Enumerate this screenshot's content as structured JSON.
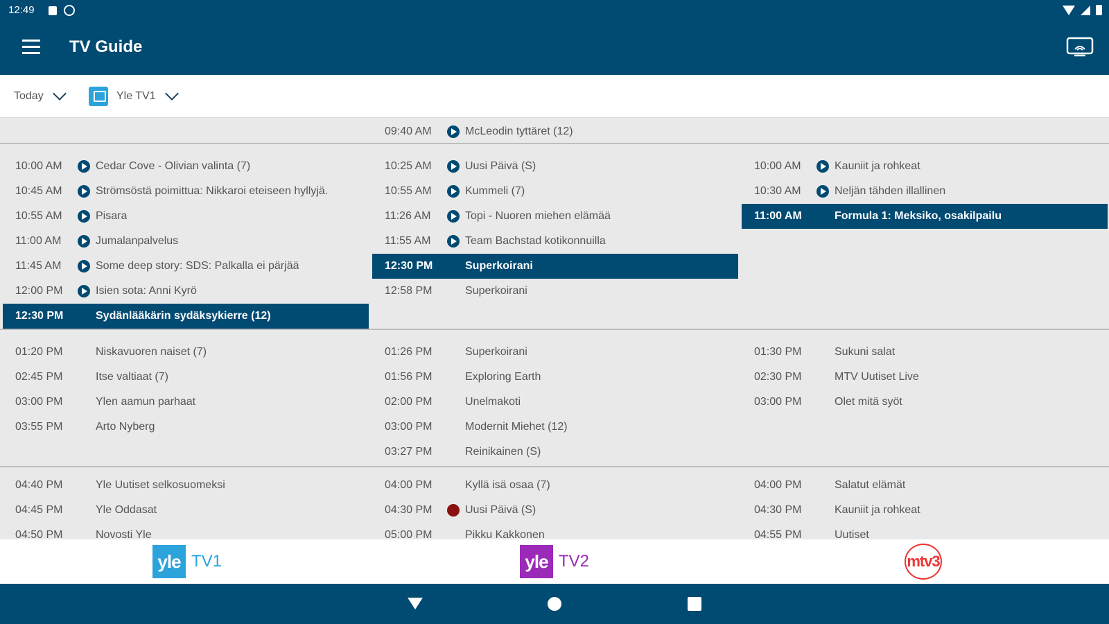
{
  "status_bar": {
    "time": "12:49"
  },
  "app_bar": {
    "title": "TV Guide"
  },
  "filters": {
    "day": "Today",
    "channel": "Yle TV1"
  },
  "colors": {
    "primary": "#014a72",
    "yle_tv1": "#2da3dc",
    "yle_tv2": "#9b2ab8",
    "mtv3": "#e33333",
    "record": "#8b1010"
  },
  "schedule": {
    "columns": [
      {
        "channel": "Yle TV1",
        "groups": [
          [],
          [
            {
              "time": "10:00 AM",
              "title": "Cedar Cove - Olivian valinta (7)",
              "indicator": "play"
            },
            {
              "time": "10:45 AM",
              "title": "Strömsöstä poimittua: Nikkaroi eteiseen hyllyjä.",
              "indicator": "play"
            },
            {
              "time": "10:55 AM",
              "title": "Pisara",
              "indicator": "play"
            },
            {
              "time": "11:00 AM",
              "title": "Jumalanpalvelus",
              "indicator": "play"
            },
            {
              "time": "11:45 AM",
              "title": "Some deep story: SDS: Palkalla ei pärjää",
              "indicator": "play"
            },
            {
              "time": "12:00 PM",
              "title": "Isien sota: Anni Kyrö",
              "indicator": "play"
            },
            {
              "time": "12:30 PM",
              "title": "Sydänlääkärin sydäksykierre (12)",
              "indicator": "none",
              "current": true
            }
          ],
          [
            {
              "time": "01:20 PM",
              "title": "Niskavuoren naiset (7)",
              "indicator": "none"
            },
            {
              "time": "02:45 PM",
              "title": "Itse valtiaat (7)",
              "indicator": "none"
            },
            {
              "time": "03:00 PM",
              "title": "Ylen aamun parhaat",
              "indicator": "none"
            },
            {
              "time": "03:55 PM",
              "title": "Arto Nyberg",
              "indicator": "none"
            }
          ],
          [
            {
              "time": "04:40 PM",
              "title": "Yle Uutiset selkosuomeksi",
              "indicator": "none"
            },
            {
              "time": "04:45 PM",
              "title": "Yle Oddasat",
              "indicator": "none"
            },
            {
              "time": "04:50 PM",
              "title": "Novosti Yle",
              "indicator": "none"
            }
          ]
        ]
      },
      {
        "channel": "Yle TV2",
        "groups": [
          [
            {
              "time": "09:40 AM",
              "title": "McLeodin tyttäret (12)",
              "indicator": "play"
            }
          ],
          [
            {
              "time": "10:25 AM",
              "title": "Uusi Päivä (S)",
              "indicator": "play"
            },
            {
              "time": "10:55 AM",
              "title": "Kummeli (7)",
              "indicator": "play"
            },
            {
              "time": "11:26 AM",
              "title": "Topi - Nuoren miehen elämää",
              "indicator": "play"
            },
            {
              "time": "11:55 AM",
              "title": "Team Bachstad kotikonnuilla",
              "indicator": "play"
            },
            {
              "time": "12:30 PM",
              "title": "Superkoirani",
              "indicator": "none",
              "current": true
            },
            {
              "time": "12:58 PM",
              "title": "Superkoirani",
              "indicator": "none"
            }
          ],
          [
            {
              "time": "01:26 PM",
              "title": "Superkoirani",
              "indicator": "none"
            },
            {
              "time": "01:56 PM",
              "title": "Exploring Earth",
              "indicator": "none"
            },
            {
              "time": "02:00 PM",
              "title": "Unelmakoti",
              "indicator": "none"
            },
            {
              "time": "03:00 PM",
              "title": "Modernit Miehet (12)",
              "indicator": "none"
            },
            {
              "time": "03:27 PM",
              "title": "Reinikainen (S)",
              "indicator": "none"
            }
          ],
          [
            {
              "time": "04:00 PM",
              "title": "Kyllä isä osaa (7)",
              "indicator": "none"
            },
            {
              "time": "04:30 PM",
              "title": "Uusi Päivä (S)",
              "indicator": "record"
            },
            {
              "time": "05:00 PM",
              "title": "Pikku Kakkonen",
              "indicator": "none"
            }
          ]
        ]
      },
      {
        "channel": "MTV3",
        "groups": [
          [],
          [
            {
              "time": "10:00 AM",
              "title": "Kauniit ja rohkeat",
              "indicator": "play"
            },
            {
              "time": "10:30 AM",
              "title": "Neljän tähden illallinen",
              "indicator": "play"
            },
            {
              "time": "11:00 AM",
              "title": "Formula 1: Meksiko, osakilpailu",
              "indicator": "none",
              "current": true
            }
          ],
          [
            {
              "time": "01:30 PM",
              "title": "Sukuni salat",
              "indicator": "none"
            },
            {
              "time": "02:30 PM",
              "title": "MTV Uutiset Live",
              "indicator": "none"
            },
            {
              "time": "03:00 PM",
              "title": "Olet mitä syöt",
              "indicator": "none"
            }
          ],
          [
            {
              "time": "04:00 PM",
              "title": "Salatut elämät",
              "indicator": "none"
            },
            {
              "time": "04:30 PM",
              "title": "Kauniit ja rohkeat",
              "indicator": "none"
            },
            {
              "time": "04:55 PM",
              "title": "Uutiset",
              "indicator": "none"
            }
          ]
        ]
      }
    ]
  },
  "channel_tabs": [
    {
      "logo_text": "yle",
      "name": "TV1"
    },
    {
      "logo_text": "yle",
      "name": "TV2"
    },
    {
      "logo_text": "mtv3",
      "name": ""
    }
  ]
}
